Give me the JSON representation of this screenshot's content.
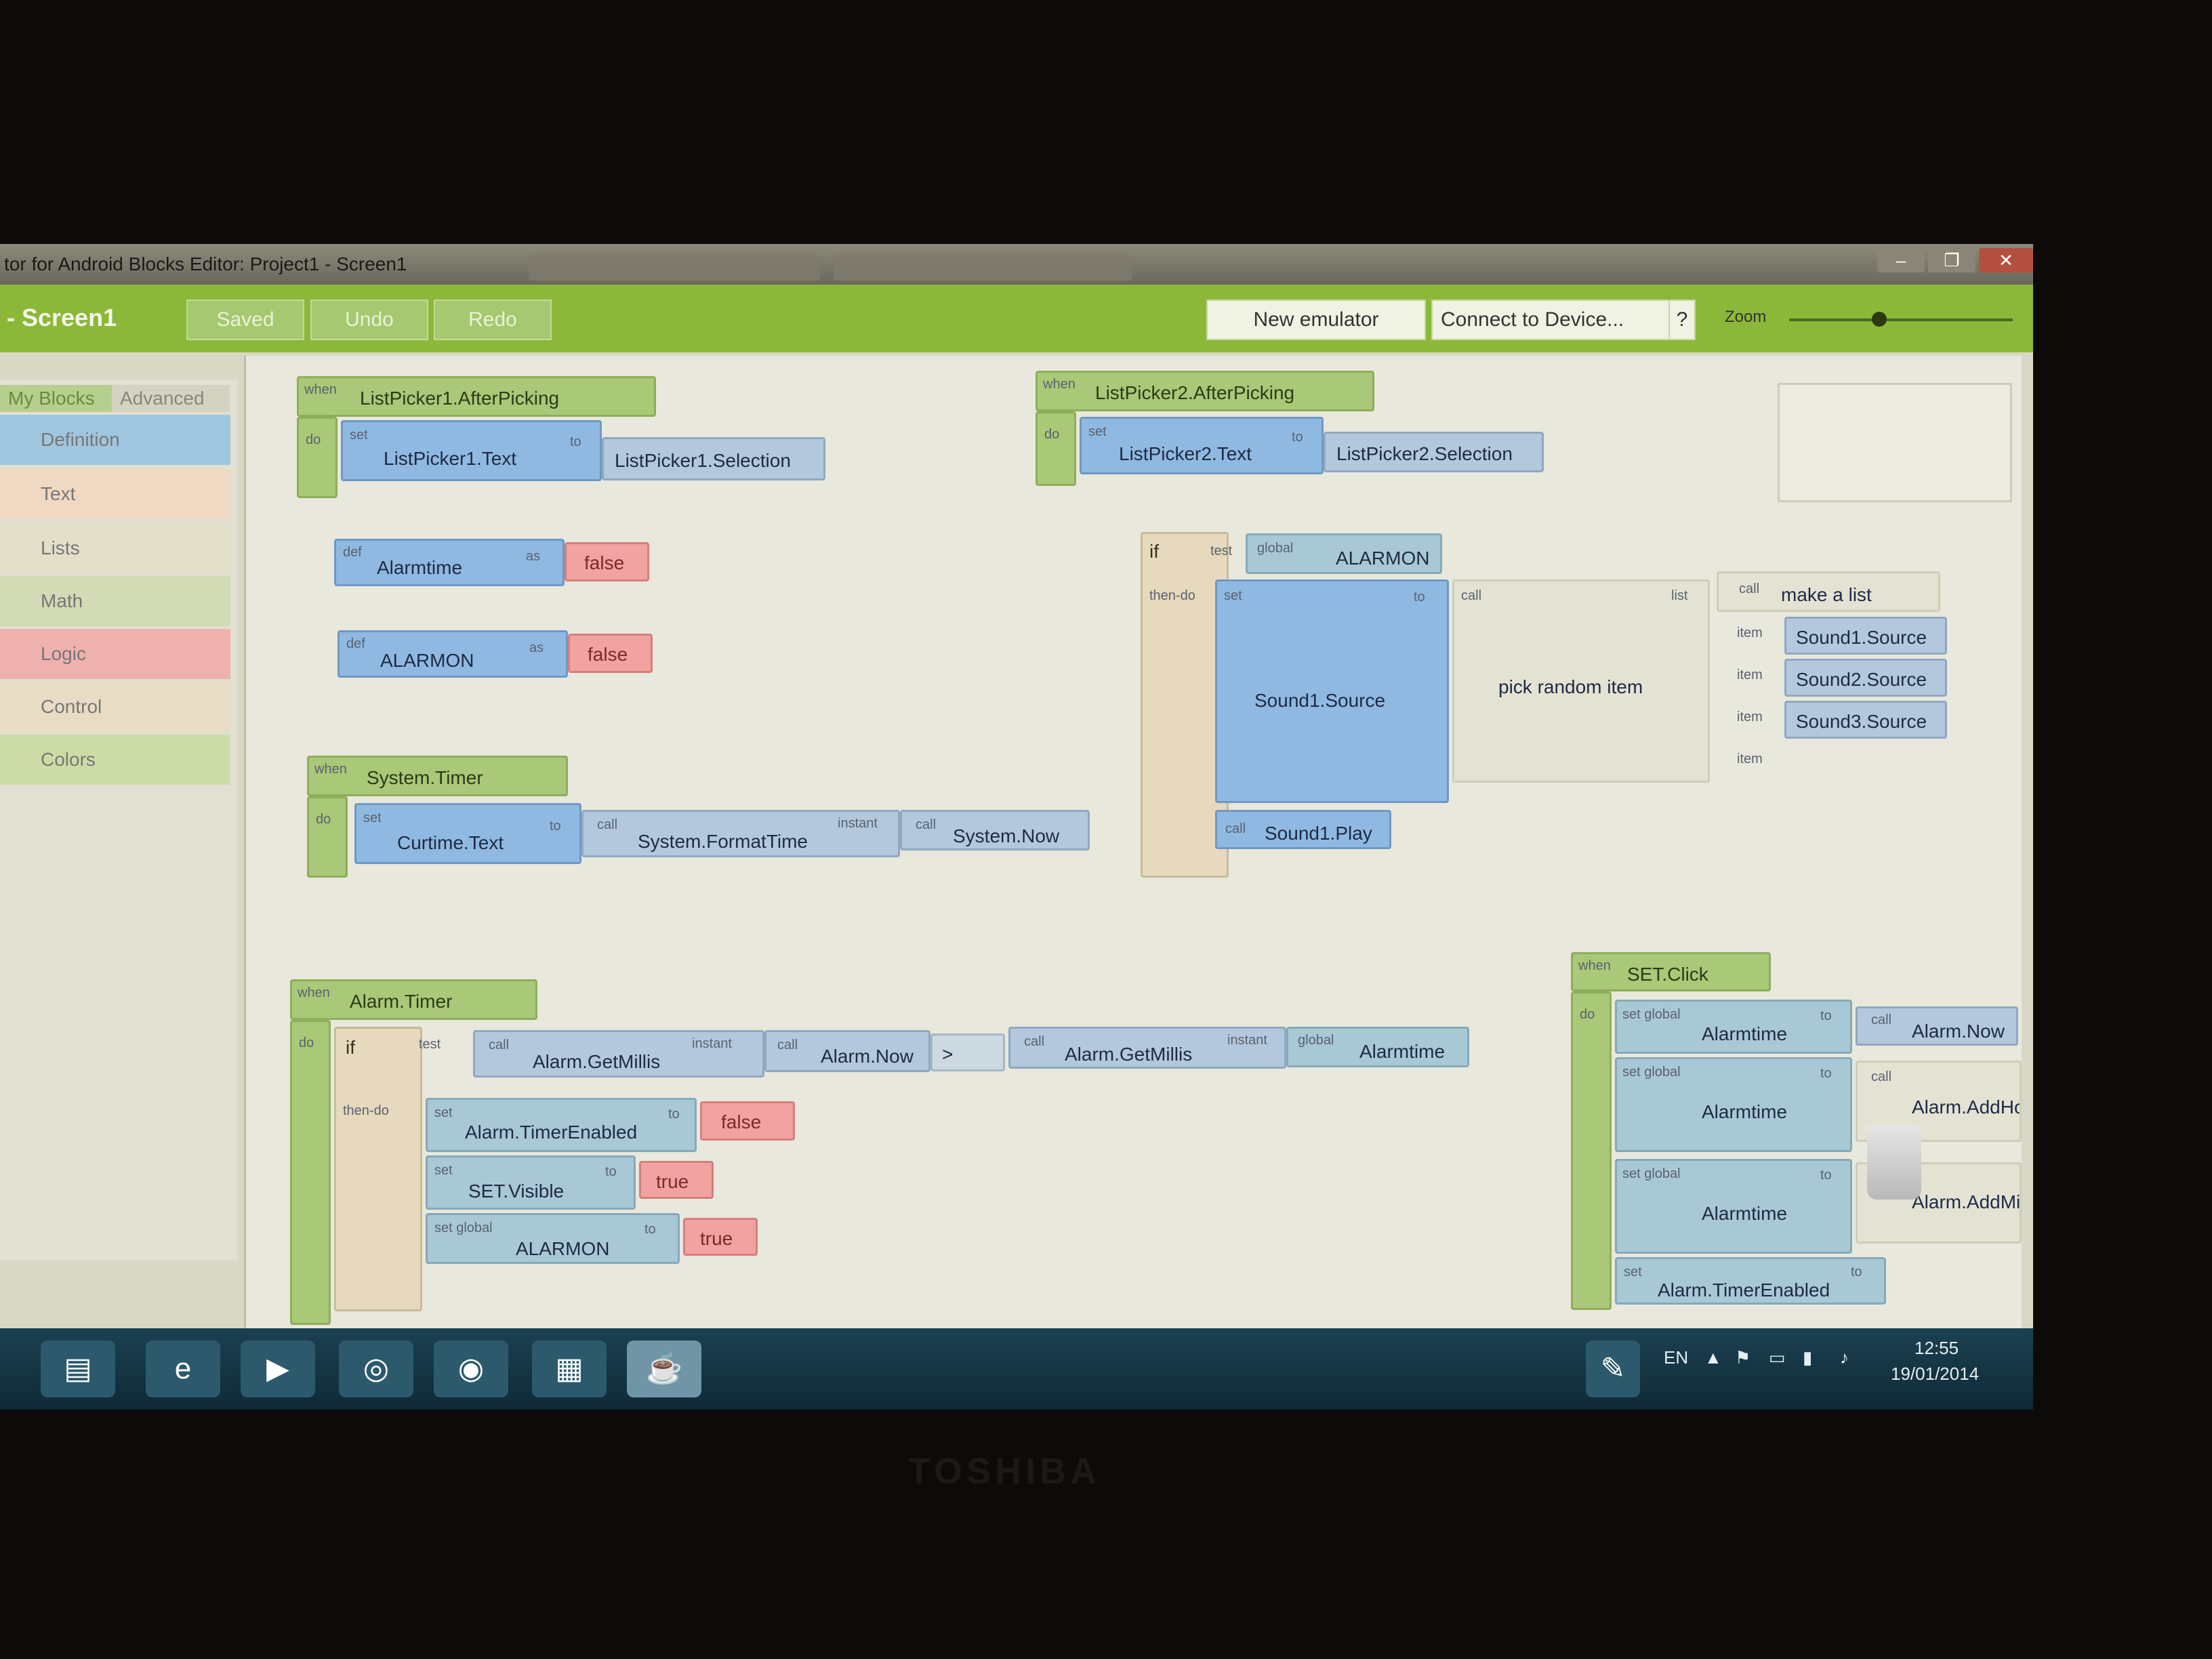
{
  "window": {
    "title": "tor for Android Blocks Editor: Project1 - Screen1",
    "controls": [
      "–",
      "❐",
      "✕"
    ]
  },
  "toolbar": {
    "app_name": "- Screen1",
    "saved": "Saved",
    "undo": "Undo",
    "redo": "Redo",
    "new_emulator": "New emulator",
    "connect": "Connect to Device...",
    "help": "?",
    "zoom": "Zoom"
  },
  "sidebar": {
    "tabs": [
      "My Blocks",
      "Advanced"
    ],
    "categories": [
      {
        "label": "Definition",
        "color": "#9fc6de"
      },
      {
        "label": "Text",
        "color": "#efd9c2"
      },
      {
        "label": "Lists",
        "color": "#e3dfc8"
      },
      {
        "label": "Math",
        "color": "#d2dbb5"
      },
      {
        "label": "Logic",
        "color": "#efb1ae"
      },
      {
        "label": "Control",
        "color": "#e8dcc4"
      },
      {
        "label": "Colors",
        "color": "#cddca6"
      }
    ]
  },
  "blocks": {
    "lp1": {
      "when": "when",
      "event": "ListPicker1.AfterPicking",
      "do": "do",
      "set": "set",
      "target": "ListPicker1.Text",
      "to": "to",
      "value": "ListPicker1.Selection"
    },
    "lp2": {
      "when": "when",
      "event": "ListPicker2.AfterPicking",
      "do": "do",
      "set": "set",
      "target": "ListPicker2.Text",
      "to": "to",
      "value": "ListPicker2.Selection"
    },
    "def1": {
      "def": "def",
      "name": "Alarmtime",
      "as": "as",
      "value": "false"
    },
    "def2": {
      "def": "def",
      "name": "ALARMON",
      "as": "as",
      "value": "false"
    },
    "timer": {
      "when": "when",
      "event": "System.Timer",
      "do": "do",
      "set": "set",
      "target": "Curtime.Text",
      "to": "to",
      "call": "call",
      "fn": "System.FormatTime",
      "instant": "instant",
      "call2": "call",
      "fn2": "System.Now"
    },
    "ifalarm": {
      "if": "if",
      "test": "test",
      "global": "global",
      "var": "ALARMON",
      "thendo": "then-do",
      "set": "set",
      "target": "Sound1.Source",
      "to": "to",
      "call": "call",
      "fn": "pick random item",
      "list": "list",
      "call2": "call",
      "mklist": "make a list",
      "item": "item",
      "items": [
        "Sound1.Source",
        "Sound2.Source",
        "Sound3.Source"
      ],
      "call3": "call",
      "play": "Sound1.Play"
    },
    "alarm": {
      "when": "when",
      "event": "Alarm.Timer",
      "do": "do",
      "if": "if",
      "test": "test",
      "call": "call",
      "fn": "Alarm.GetMillis",
      "instant": "instant",
      "call2": "call",
      "now": "Alarm.Now",
      "op": ">",
      "call3": "call",
      "fn2": "Alarm.GetMillis",
      "instant2": "instant",
      "global": "global",
      "var": "Alarmtime",
      "thendo": "then-do",
      "set1": "set",
      "t1": "Alarm.TimerEnabled",
      "to": "to",
      "v1": "false",
      "set2": "set",
      "t2": "SET.Visible",
      "v2": "true",
      "set3": "set global",
      "t3": "ALARMON",
      "v3": "true"
    },
    "setclick": {
      "when": "when",
      "event": "SET.Click",
      "do": "do",
      "setg": "set global",
      "var": "Alarmtime",
      "to": "to",
      "call": "call",
      "fn1": "Alarm.Now",
      "fn2": "Alarm.AddHou",
      "fn3": "Alarm.AddMi",
      "set": "set",
      "t4": "Alarm.TimerEnabled"
    }
  },
  "taskbar": {
    "lang": "EN",
    "time": "12:55",
    "date": "19/01/2014"
  },
  "bezel": {
    "brand": "TOSHIBA"
  }
}
